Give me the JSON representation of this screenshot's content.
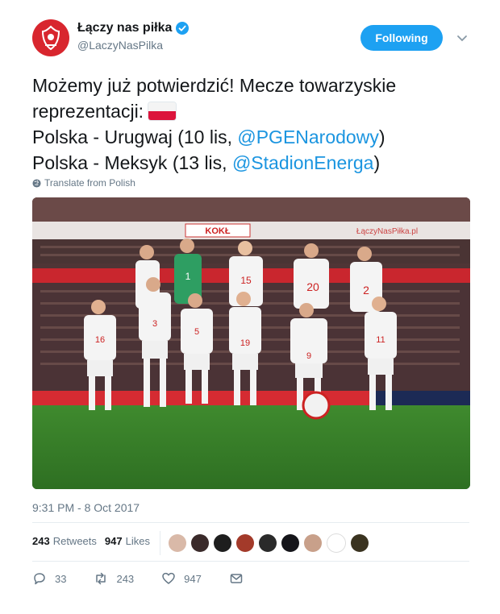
{
  "account": {
    "display_name": "Łączy nas piłka",
    "handle": "@LaczyNasPilka",
    "verified": true,
    "avatar_icon": "pzpn-logo-icon",
    "avatar_color": "#d8262e"
  },
  "follow_button": {
    "label": "Following",
    "color": "#1da1f2"
  },
  "tweet": {
    "line1": "Możemy już potwierdzić! Mecze towarzyskie",
    "line2": "reprezentacji:",
    "line3_prefix": "Polska - Urugwaj (10 lis, ",
    "line3_mention": "@PGENarodowy",
    "line3_suffix": ")",
    "line4_prefix": "Polska - Meksyk (13 lis, ",
    "line4_mention": "@StadionEnerga",
    "line4_suffix": ")",
    "flag_icon": "poland-flag-icon"
  },
  "translate_label": "Translate from Polish",
  "photo": {
    "jersey_numbers_back": [
      "1",
      "15",
      "20",
      "2"
    ],
    "jersey_numbers_front": [
      "16",
      "3",
      "5",
      "19",
      "9",
      "11"
    ],
    "banner_text": "KOKŁ",
    "sponsor_text": "ŁączyNasPiłka.pl"
  },
  "timestamp": "9:31 PM - 8 Oct 2017",
  "stats": {
    "retweets_count": "243",
    "retweets_label": "Retweets",
    "likes_count": "947",
    "likes_label": "Likes"
  },
  "actions": {
    "reply_count": "33",
    "retweet_count": "243",
    "like_count": "947"
  },
  "colors": {
    "link": "#1b95e0",
    "muted": "#657786",
    "accent": "#1da1f2"
  }
}
